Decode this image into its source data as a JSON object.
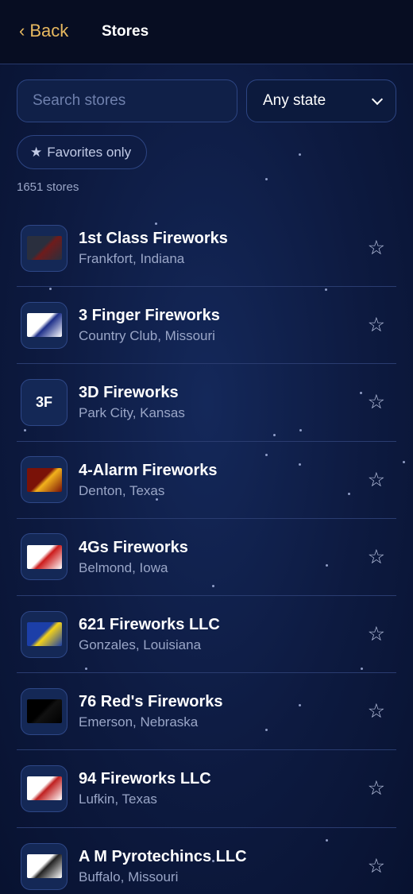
{
  "header": {
    "back_label": "Back",
    "title": "Stores"
  },
  "search": {
    "placeholder": "Search stores",
    "value": ""
  },
  "state_filter": {
    "selected": "Any state"
  },
  "favorites_toggle": {
    "label": "Favorites only"
  },
  "store_count": "1651 stores",
  "stores": [
    {
      "name": "1st Class Fireworks",
      "location": "Frankfort, Indiana",
      "logo": "image",
      "logo_bg": "#2a2f3e",
      "logo_fg": "#6f1b1b"
    },
    {
      "name": "3 Finger Fireworks",
      "location": "Country Club, Missouri",
      "logo": "image",
      "logo_bg": "#ffffff",
      "logo_fg": "#1d2f8a"
    },
    {
      "name": "3D Fireworks",
      "location": "Park City, Kansas",
      "logo": "initials",
      "initials": "3F"
    },
    {
      "name": "4-Alarm Fireworks",
      "location": "Denton, Texas",
      "logo": "image",
      "logo_bg": "#7a1208",
      "logo_fg": "#f2b21c"
    },
    {
      "name": "4Gs Fireworks",
      "location": "Belmond, Iowa",
      "logo": "image",
      "logo_bg": "#ffffff",
      "logo_fg": "#cc1b1b"
    },
    {
      "name": "621 Fireworks LLC",
      "location": "Gonzales, Louisiana",
      "logo": "image",
      "logo_bg": "#1c3fa8",
      "logo_fg": "#f3d21a"
    },
    {
      "name": "76 Red's Fireworks",
      "location": "Emerson, Nebraska",
      "logo": "image",
      "logo_bg": "#000000",
      "logo_fg": "#111111"
    },
    {
      "name": "94 Fireworks LLC",
      "location": "Lufkin, Texas",
      "logo": "image",
      "logo_bg": "#ffffff",
      "logo_fg": "#c02020"
    },
    {
      "name": "A M Pyrotechincs LLC",
      "location": "Buffalo, Missouri",
      "logo": "image",
      "logo_bg": "#ffffff",
      "logo_fg": "#222222"
    }
  ],
  "colors": {
    "accent": "#e8b960",
    "background": "#0d1a40",
    "muted_text": "#9aa6c7"
  }
}
